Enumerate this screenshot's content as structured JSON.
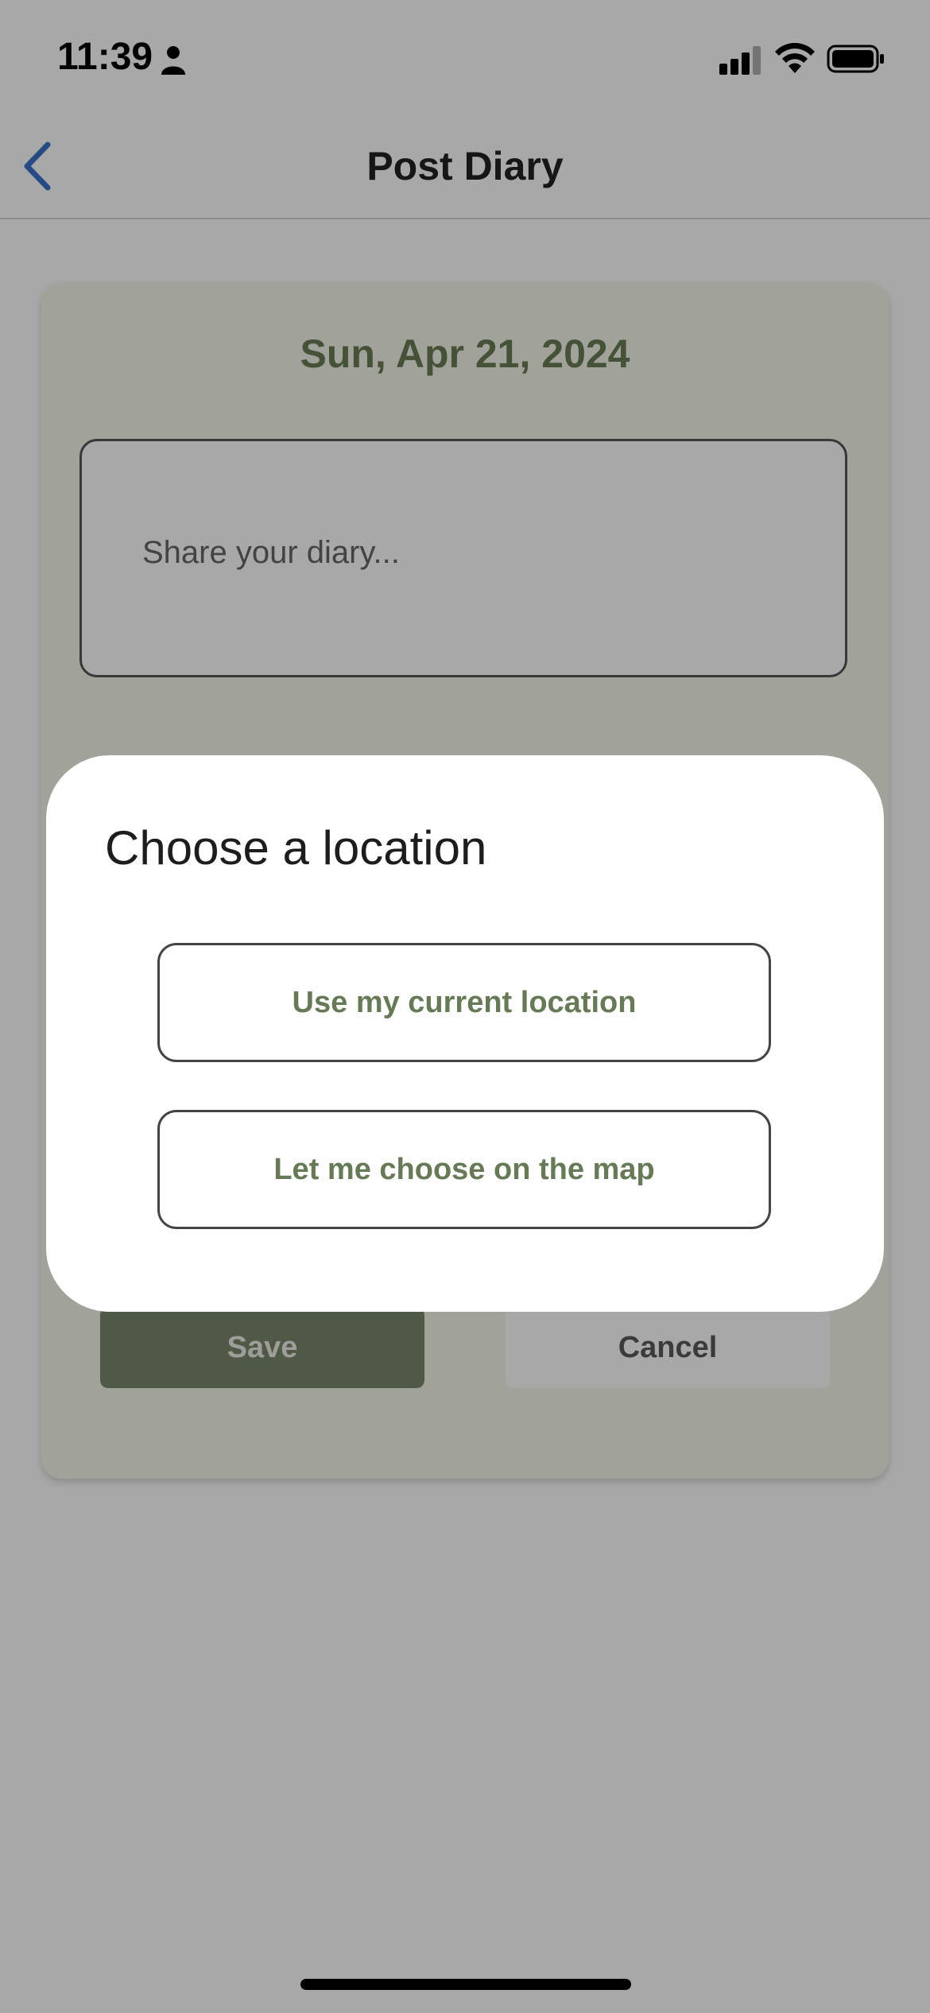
{
  "status_bar": {
    "time": "11:39",
    "icons": [
      "person-icon",
      "signal-icon",
      "wifi-icon",
      "battery-icon"
    ]
  },
  "nav": {
    "title": "Post Diary",
    "back_icon": "chevron-left-icon"
  },
  "card": {
    "date": "Sun, Apr 21, 2024",
    "diary_placeholder": "Share your diary...",
    "save_label": "Save",
    "cancel_label": "Cancel"
  },
  "dialog": {
    "title": "Choose a location",
    "options": [
      {
        "label": "Use my current location"
      },
      {
        "label": "Let me choose on the map"
      }
    ]
  },
  "colors": {
    "accent_green": "#657a55",
    "save_button_bg": "#78886a",
    "card_bg": "#f4f7ec",
    "back_icon": "#3a73c9"
  }
}
